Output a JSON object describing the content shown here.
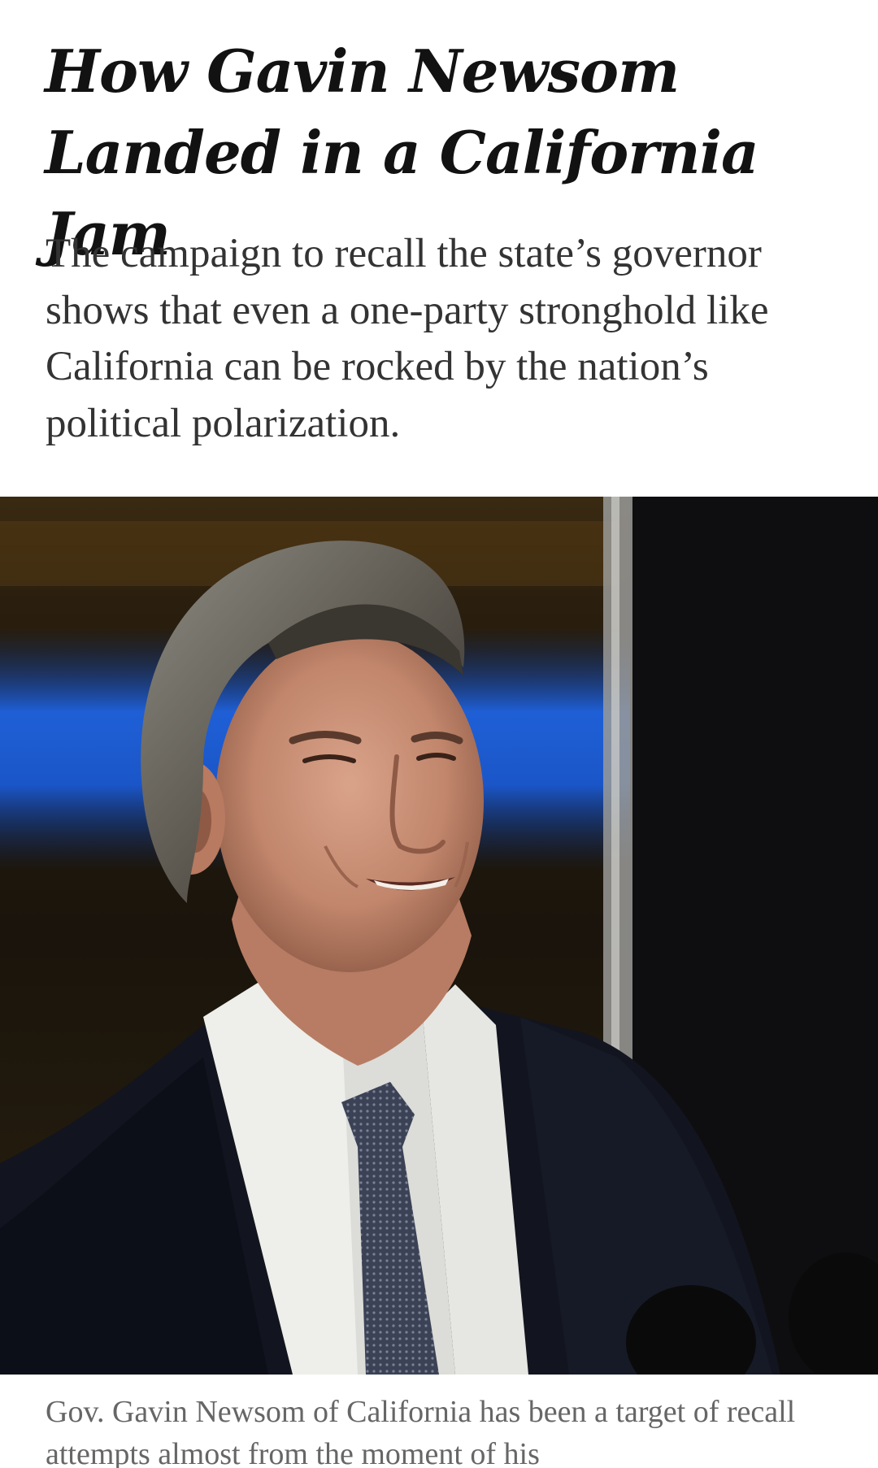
{
  "article": {
    "headline_line1": "How Gavin Newsom",
    "headline_line2": "Landed in a California Jam",
    "summary": "The campaign to recall the state’s governor shows that even a one-party stronghold like California can be rocked by the nation’s political polarization.",
    "caption": "Gov. Gavin Newsom of California has been a target of recall attempts almost from the moment of his"
  },
  "colors": {
    "headline": "#121212",
    "summary": "#333333",
    "caption": "#666666",
    "background": "#ffffff"
  }
}
